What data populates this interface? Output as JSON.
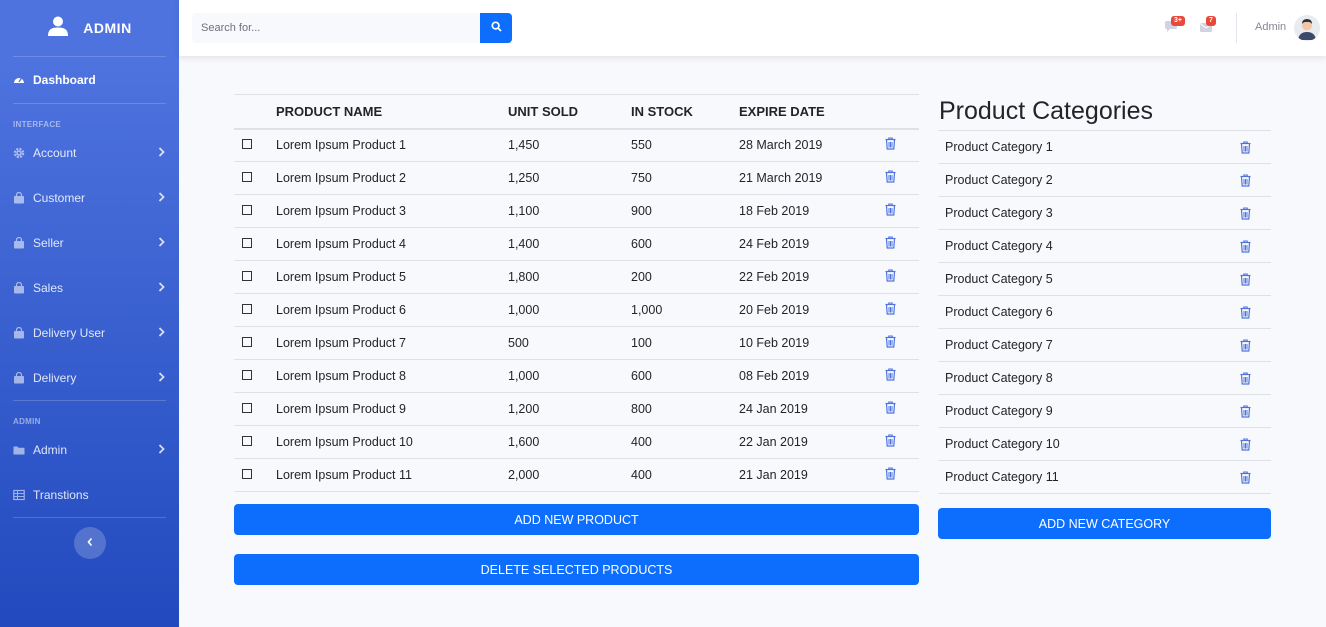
{
  "sidebar": {
    "brand": "ADMIN",
    "dashboard": "Dashboard",
    "section_interface": "INTERFACE",
    "section_admin": "ADMIN",
    "items": [
      {
        "label": "Account",
        "icon": "gear-icon"
      },
      {
        "label": "Customer",
        "icon": "shopping-bag-icon"
      },
      {
        "label": "Seller",
        "icon": "shopping-bag-icon"
      },
      {
        "label": "Sales",
        "icon": "shopping-bag-icon"
      },
      {
        "label": "Delivery User",
        "icon": "shopping-bag-icon"
      },
      {
        "label": "Delivery",
        "icon": "shopping-bag-icon"
      }
    ],
    "admin_items": [
      {
        "label": "Admin",
        "icon": "folder-icon"
      },
      {
        "label": "Transtions",
        "icon": "table-icon"
      }
    ]
  },
  "topbar": {
    "search_placeholder": "Search for...",
    "alerts_badge": "3+",
    "messages_badge": "7",
    "user_name": "Admin"
  },
  "products": {
    "headers": {
      "name": "PRODUCT NAME",
      "sold": "UNIT SOLD",
      "stock": "IN STOCK",
      "expire": "EXPIRE DATE"
    },
    "rows": [
      {
        "name": "Lorem Ipsum Product 1",
        "sold": "1,450",
        "stock": "550",
        "expire": "28 March 2019"
      },
      {
        "name": "Lorem Ipsum Product 2",
        "sold": "1,250",
        "stock": "750",
        "expire": "21 March 2019"
      },
      {
        "name": "Lorem Ipsum Product 3",
        "sold": "1,100",
        "stock": "900",
        "expire": "18 Feb 2019"
      },
      {
        "name": "Lorem Ipsum Product 4",
        "sold": "1,400",
        "stock": "600",
        "expire": "24 Feb 2019"
      },
      {
        "name": "Lorem Ipsum Product 5",
        "sold": "1,800",
        "stock": "200",
        "expire": "22 Feb 2019"
      },
      {
        "name": "Lorem Ipsum Product 6",
        "sold": "1,000",
        "stock": "1,000",
        "expire": "20 Feb 2019"
      },
      {
        "name": "Lorem Ipsum Product 7",
        "sold": "500",
        "stock": "100",
        "expire": "10 Feb 2019"
      },
      {
        "name": "Lorem Ipsum Product 8",
        "sold": "1,000",
        "stock": "600",
        "expire": "08 Feb 2019"
      },
      {
        "name": "Lorem Ipsum Product 9",
        "sold": "1,200",
        "stock": "800",
        "expire": "24 Jan 2019"
      },
      {
        "name": "Lorem Ipsum Product 10",
        "sold": "1,600",
        "stock": "400",
        "expire": "22 Jan 2019"
      },
      {
        "name": "Lorem Ipsum Product 11",
        "sold": "2,000",
        "stock": "400",
        "expire": "21 Jan 2019"
      }
    ],
    "add_label": "ADD NEW PRODUCT",
    "delete_label": "DELETE SELECTED PRODUCTS"
  },
  "categories": {
    "title": "Product Categories",
    "items": [
      "Product Category 1",
      "Product Category 2",
      "Product Category 3",
      "Product Category 4",
      "Product Category 5",
      "Product Category 6",
      "Product Category 7",
      "Product Category 8",
      "Product Category 9",
      "Product Category 10",
      "Product Category 11"
    ],
    "add_label": "ADD NEW CATEGORY"
  },
  "colors": {
    "primary": "#0d6efd",
    "sidebar_top": "#4e73df",
    "sidebar_bottom": "#224abe",
    "badge": "#e74a3b"
  }
}
